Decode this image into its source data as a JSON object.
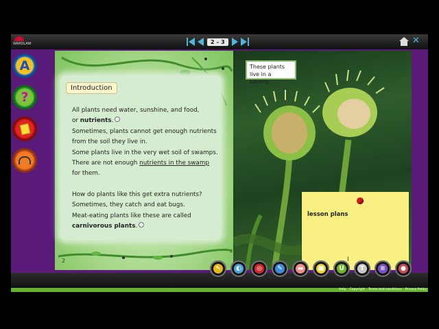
{
  "app": {
    "logo_text": "WARDLAW",
    "page_indicator": "2 – 3"
  },
  "sidebar": [
    {
      "name": "font-a-button",
      "glyph": "A",
      "ring": "#1f6fd1",
      "fill": "#f4c21b",
      "color": "#1f4fbf"
    },
    {
      "name": "help-button",
      "glyph": "?",
      "ring": "#1f9a2b",
      "fill": "#7ec43a",
      "color": "#c4169a"
    },
    {
      "name": "notes-button",
      "glyph": "",
      "ring": "#c11313",
      "fill": "#e12424",
      "color": "#f6df3a"
    },
    {
      "name": "audio-button",
      "glyph": "",
      "ring": "#d4521c",
      "fill": "#ef7d23",
      "color": "#333"
    }
  ],
  "left_page": {
    "heading": "Introduction",
    "line1": "All plants need water, sunshine, and food,",
    "line2_prefix": "or ",
    "line2_bold": "nutrients",
    "line2_suffix": ".",
    "line3": "Sometimes, plants cannot get enough nutrients",
    "line4": "from the soil they live in.",
    "line5": "Some plants live in the very wet soil of swamps.",
    "line6_prefix": "There are not enough ",
    "line6_link": "nutrients in the swamp",
    "line7": "for them.",
    "line8": "How do plants like this get extra nutrients?",
    "line9": "Sometimes, they catch and eat bugs.",
    "line10": "Meat-eating plants like these are called",
    "line11_bold": "carnivorous plants",
    "line11_suffix": ".",
    "page_number": "2"
  },
  "right_page": {
    "callout": "These plants live in a swamp.",
    "sticky_note": "lesson plans"
  },
  "toolbar": [
    {
      "name": "pointer-tool",
      "glyph": "↖",
      "color": "#e8b81a"
    },
    {
      "name": "spotlight-tool",
      "glyph": "◐",
      "color": "#4aa3dd"
    },
    {
      "name": "zoom-tool",
      "glyph": "◎",
      "color": "#d9232a"
    },
    {
      "name": "pen-tool",
      "glyph": "✎",
      "color": "#3b8de0"
    },
    {
      "name": "eraser-tool",
      "glyph": "▬",
      "color": "#f28c8c"
    },
    {
      "name": "highlighter-tool",
      "glyph": "■",
      "color": "#f4d31b"
    },
    {
      "name": "underline-tool",
      "glyph": "U",
      "color": "#6fb62b"
    },
    {
      "name": "text-tool",
      "glyph": "T",
      "color": "#c8c8c8"
    },
    {
      "name": "screen-tool",
      "glyph": "≋",
      "color": "#7b4fc7"
    },
    {
      "name": "record-tool",
      "glyph": "●",
      "color": "#c94b57"
    }
  ],
  "footer": {
    "links": [
      "Help",
      "Copyright",
      "Terms and conditions",
      "Privacy Policy"
    ]
  }
}
